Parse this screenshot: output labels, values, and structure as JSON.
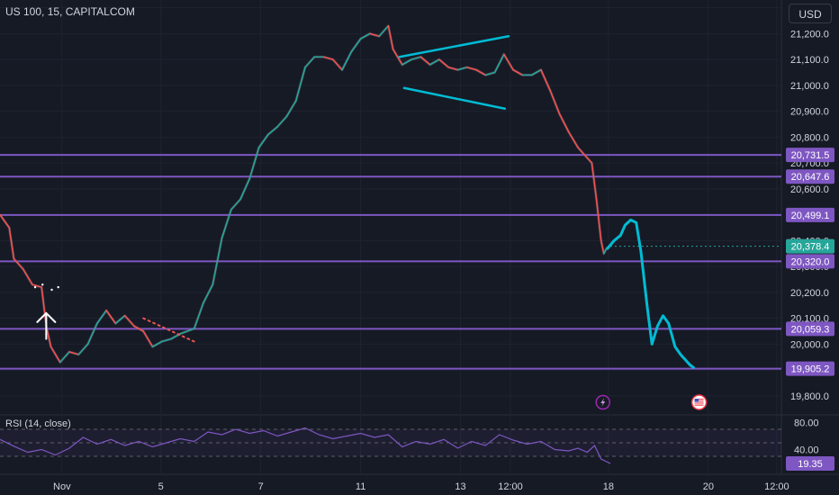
{
  "header": {
    "symbol": "US 100, 15, CAPITALCOM",
    "currency_button": "USD"
  },
  "colors": {
    "background": "#161a25",
    "up": "#26a69a",
    "down": "#ef5350",
    "level_line": "#7e57c2",
    "drawing": "#00bcd4",
    "rsi_line": "#7e57c2"
  },
  "chart_data": {
    "type": "line",
    "title": "US 100, 15, CAPITALCOM",
    "xlabel": "",
    "ylabel": "",
    "price_axis": {
      "ylim": [
        19730,
        21330
      ],
      "ticks": [
        "21,300.0",
        "21,200.0",
        "21,100.0",
        "21,000.0",
        "20,900.0",
        "20,800.0",
        "20,700.0",
        "20,600.0",
        "20,500.0",
        "20,400.0",
        "20,300.0",
        "20,200.0",
        "20,100.0",
        "20,000.0",
        "19,900.0",
        "19,800.0"
      ]
    },
    "time_axis": {
      "range": [
        0,
        84.5
      ],
      "ticks": [
        {
          "label": "Nov",
          "t": 6.7
        },
        {
          "label": "5",
          "t": 17.4
        },
        {
          "label": "7",
          "t": 28.2
        },
        {
          "label": "11",
          "t": 39.0
        },
        {
          "label": "13",
          "t": 49.8
        },
        {
          "label": "12:00",
          "t": 55.2
        },
        {
          "label": "18",
          "t": 65.8
        },
        {
          "label": "20",
          "t": 76.6
        },
        {
          "label": "12:00",
          "t": 84.0
        }
      ]
    },
    "price_path": [
      {
        "t": 0.0,
        "y": 20500
      },
      {
        "t": 1.0,
        "y": 20450
      },
      {
        "t": 1.5,
        "y": 20330
      },
      {
        "t": 2.5,
        "y": 20290
      },
      {
        "t": 3.5,
        "y": 20230
      },
      {
        "t": 4.5,
        "y": 20220
      },
      {
        "t": 5.0,
        "y": 20070
      },
      {
        "t": 5.5,
        "y": 19990
      },
      {
        "t": 6.5,
        "y": 19930
      },
      {
        "t": 7.5,
        "y": 19970
      },
      {
        "t": 8.5,
        "y": 19960
      },
      {
        "t": 9.5,
        "y": 20000
      },
      {
        "t": 10.5,
        "y": 20080
      },
      {
        "t": 11.5,
        "y": 20130
      },
      {
        "t": 12.5,
        "y": 20080
      },
      {
        "t": 13.5,
        "y": 20110
      },
      {
        "t": 14.5,
        "y": 20070
      },
      {
        "t": 15.5,
        "y": 20050
      },
      {
        "t": 16.5,
        "y": 19990
      },
      {
        "t": 17.5,
        "y": 20010
      },
      {
        "t": 18.5,
        "y": 20020
      },
      {
        "t": 19.5,
        "y": 20040
      },
      {
        "t": 21.0,
        "y": 20060
      },
      {
        "t": 22.0,
        "y": 20160
      },
      {
        "t": 23.0,
        "y": 20230
      },
      {
        "t": 24.0,
        "y": 20410
      },
      {
        "t": 25.0,
        "y": 20520
      },
      {
        "t": 26.0,
        "y": 20560
      },
      {
        "t": 27.0,
        "y": 20640
      },
      {
        "t": 28.0,
        "y": 20760
      },
      {
        "t": 29.0,
        "y": 20810
      },
      {
        "t": 30.0,
        "y": 20840
      },
      {
        "t": 31.0,
        "y": 20880
      },
      {
        "t": 32.0,
        "y": 20940
      },
      {
        "t": 33.0,
        "y": 21070
      },
      {
        "t": 34.0,
        "y": 21110
      },
      {
        "t": 35.0,
        "y": 21110
      },
      {
        "t": 36.0,
        "y": 21100
      },
      {
        "t": 37.0,
        "y": 21060
      },
      {
        "t": 38.0,
        "y": 21130
      },
      {
        "t": 39.0,
        "y": 21180
      },
      {
        "t": 40.0,
        "y": 21200
      },
      {
        "t": 41.0,
        "y": 21190
      },
      {
        "t": 42.0,
        "y": 21230
      },
      {
        "t": 42.5,
        "y": 21140
      },
      {
        "t": 43.5,
        "y": 21080
      },
      {
        "t": 44.5,
        "y": 21100
      },
      {
        "t": 45.5,
        "y": 21110
      },
      {
        "t": 46.5,
        "y": 21080
      },
      {
        "t": 47.5,
        "y": 21100
      },
      {
        "t": 48.5,
        "y": 21070
      },
      {
        "t": 49.5,
        "y": 21060
      },
      {
        "t": 50.5,
        "y": 21070
      },
      {
        "t": 51.5,
        "y": 21060
      },
      {
        "t": 52.5,
        "y": 21040
      },
      {
        "t": 53.5,
        "y": 21050
      },
      {
        "t": 54.5,
        "y": 21120
      },
      {
        "t": 55.5,
        "y": 21060
      },
      {
        "t": 56.5,
        "y": 21040
      },
      {
        "t": 57.5,
        "y": 21040
      },
      {
        "t": 58.5,
        "y": 21060
      },
      {
        "t": 59.5,
        "y": 20980
      },
      {
        "t": 60.5,
        "y": 20890
      },
      {
        "t": 61.5,
        "y": 20820
      },
      {
        "t": 62.5,
        "y": 20760
      },
      {
        "t": 63.5,
        "y": 20720
      },
      {
        "t": 64.0,
        "y": 20700
      },
      {
        "t": 64.5,
        "y": 20560
      },
      {
        "t": 65.0,
        "y": 20400
      },
      {
        "t": 65.3,
        "y": 20350
      },
      {
        "t": 65.6,
        "y": 20370
      },
      {
        "t": 66.0,
        "y": 20380
      }
    ],
    "horizontal_levels": [
      {
        "label": "20,731.5",
        "y": 20731.5
      },
      {
        "label": "20,647.6",
        "y": 20647.6
      },
      {
        "label": "20,499.1",
        "y": 20499.1
      },
      {
        "label": "20,320.0",
        "y": 20320.0
      },
      {
        "label": "20,059.3",
        "y": 20059.3
      },
      {
        "label": "19,905.2",
        "y": 19905.2
      }
    ],
    "current_price": {
      "label": "20,378.4",
      "y": 20378.4
    },
    "drawings": {
      "wedge_upper": [
        {
          "t": 43.2,
          "y": 21110
        },
        {
          "t": 55.0,
          "y": 21190
        }
      ],
      "wedge_lower": [
        {
          "t": 43.7,
          "y": 20990
        },
        {
          "t": 54.6,
          "y": 20910
        }
      ],
      "projection_path": [
        {
          "t": 65.7,
          "y": 20370
        },
        {
          "t": 66.4,
          "y": 20400
        },
        {
          "t": 67.1,
          "y": 20420
        },
        {
          "t": 67.6,
          "y": 20460
        },
        {
          "t": 68.2,
          "y": 20480
        },
        {
          "t": 68.8,
          "y": 20470
        },
        {
          "t": 69.3,
          "y": 20360
        },
        {
          "t": 70.0,
          "y": 20140
        },
        {
          "t": 70.5,
          "y": 20000
        },
        {
          "t": 71.1,
          "y": 20070
        },
        {
          "t": 71.7,
          "y": 20110
        },
        {
          "t": 72.3,
          "y": 20080
        },
        {
          "t": 73.0,
          "y": 19990
        },
        {
          "t": 73.6,
          "y": 19960
        },
        {
          "t": 74.1,
          "y": 19940
        },
        {
          "t": 74.6,
          "y": 19920
        },
        {
          "t": 75.0,
          "y": 19910
        }
      ],
      "dotted_trend": [
        {
          "t": 15.5,
          "y": 20100
        },
        {
          "t": 21.0,
          "y": 20010
        }
      ],
      "arrow": {
        "t": 5.0,
        "from": 20020,
        "to": 20120
      },
      "arrow_dots": [
        {
          "t": 3.8,
          "y": 20220
        },
        {
          "t": 4.6,
          "y": 20230
        },
        {
          "t": 5.6,
          "y": 20210
        },
        {
          "t": 6.3,
          "y": 20220
        }
      ]
    },
    "rsi": {
      "label": "RSI (14, close)",
      "ylim": [
        10,
        90
      ],
      "ticks": [
        "80.00",
        "40.00"
      ],
      "band": [
        30,
        70
      ],
      "value_label": "19.35",
      "path": [
        {
          "t": 0,
          "y": 55
        },
        {
          "t": 1.5,
          "y": 45
        },
        {
          "t": 3,
          "y": 36
        },
        {
          "t": 4.5,
          "y": 40
        },
        {
          "t": 6,
          "y": 32
        },
        {
          "t": 7.5,
          "y": 42
        },
        {
          "t": 9,
          "y": 58
        },
        {
          "t": 10.5,
          "y": 48
        },
        {
          "t": 12,
          "y": 55
        },
        {
          "t": 13.5,
          "y": 46
        },
        {
          "t": 15,
          "y": 52
        },
        {
          "t": 16.5,
          "y": 44
        },
        {
          "t": 18,
          "y": 50
        },
        {
          "t": 19.5,
          "y": 56
        },
        {
          "t": 21,
          "y": 52
        },
        {
          "t": 22.5,
          "y": 66
        },
        {
          "t": 24,
          "y": 62
        },
        {
          "t": 25.5,
          "y": 70
        },
        {
          "t": 27,
          "y": 64
        },
        {
          "t": 28.5,
          "y": 68
        },
        {
          "t": 30,
          "y": 60
        },
        {
          "t": 31.5,
          "y": 66
        },
        {
          "t": 33,
          "y": 72
        },
        {
          "t": 34.5,
          "y": 62
        },
        {
          "t": 36,
          "y": 56
        },
        {
          "t": 37.5,
          "y": 60
        },
        {
          "t": 39,
          "y": 64
        },
        {
          "t": 40.5,
          "y": 58
        },
        {
          "t": 42,
          "y": 62
        },
        {
          "t": 43.5,
          "y": 44
        },
        {
          "t": 45,
          "y": 52
        },
        {
          "t": 46.5,
          "y": 48
        },
        {
          "t": 48,
          "y": 55
        },
        {
          "t": 49.5,
          "y": 42
        },
        {
          "t": 51,
          "y": 52
        },
        {
          "t": 52.5,
          "y": 46
        },
        {
          "t": 54,
          "y": 62
        },
        {
          "t": 55.5,
          "y": 54
        },
        {
          "t": 57,
          "y": 48
        },
        {
          "t": 58.5,
          "y": 52
        },
        {
          "t": 60,
          "y": 40
        },
        {
          "t": 61.5,
          "y": 38
        },
        {
          "t": 62.5,
          "y": 42
        },
        {
          "t": 63.5,
          "y": 36
        },
        {
          "t": 64.3,
          "y": 46
        },
        {
          "t": 65,
          "y": 26
        },
        {
          "t": 66,
          "y": 19.35
        }
      ]
    },
    "event_icons": [
      {
        "name": "lightning-icon",
        "t": 65.2
      },
      {
        "name": "us-flag-icon",
        "t": 75.6
      }
    ]
  }
}
